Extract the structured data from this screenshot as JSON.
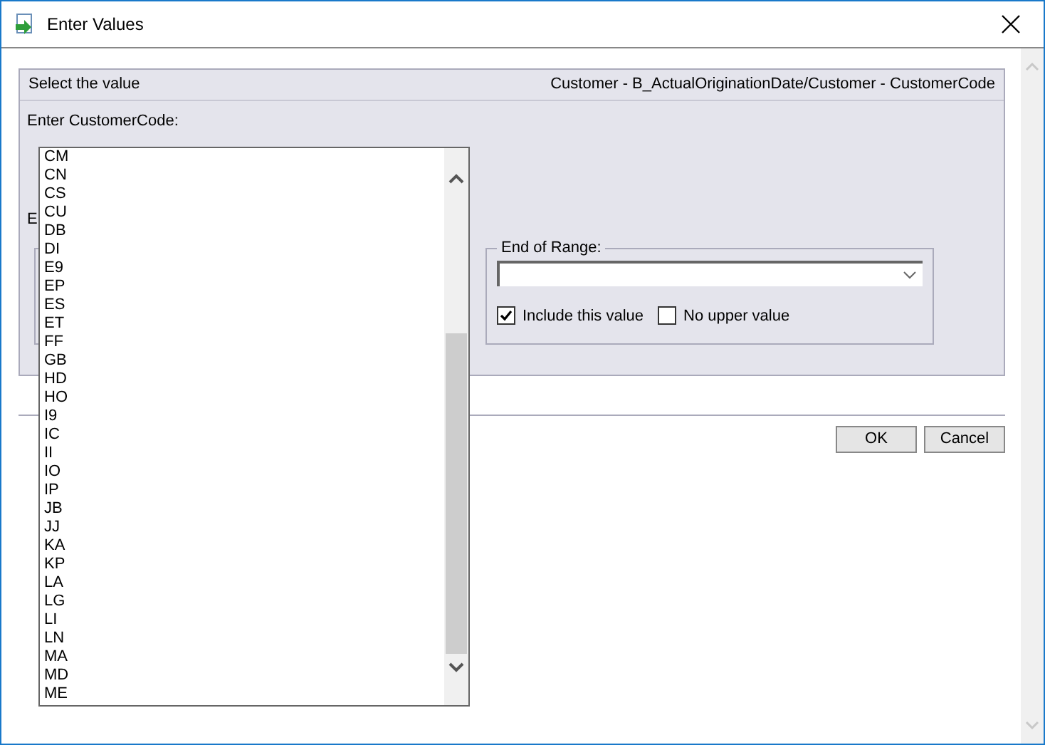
{
  "window": {
    "title": "Enter Values"
  },
  "panel": {
    "title": "Select the value",
    "path": "Customer - B_ActualOriginationDate/Customer - CustomerCode",
    "prompt": "Enter CustomerCode:",
    "covered_label": "E"
  },
  "end_of_range": {
    "legend": "End of Range:",
    "include": {
      "label": "Include this value",
      "checked": true
    },
    "no_upper": {
      "label": "No upper value",
      "checked": false
    }
  },
  "buttons": [
    "OK",
    "Cancel"
  ],
  "list": {
    "items": [
      "CM",
      "CN",
      "CS",
      "CU",
      "DB",
      "DI",
      "E9",
      "EP",
      "ES",
      "ET",
      "FF",
      "GB",
      "HD",
      "HO",
      "I9",
      "IC",
      "II",
      "IO",
      "IP",
      "JB",
      "JJ",
      "KA",
      "KP",
      "LA",
      "LG",
      "LI",
      "LN",
      "MA",
      "MD",
      "ME"
    ]
  }
}
